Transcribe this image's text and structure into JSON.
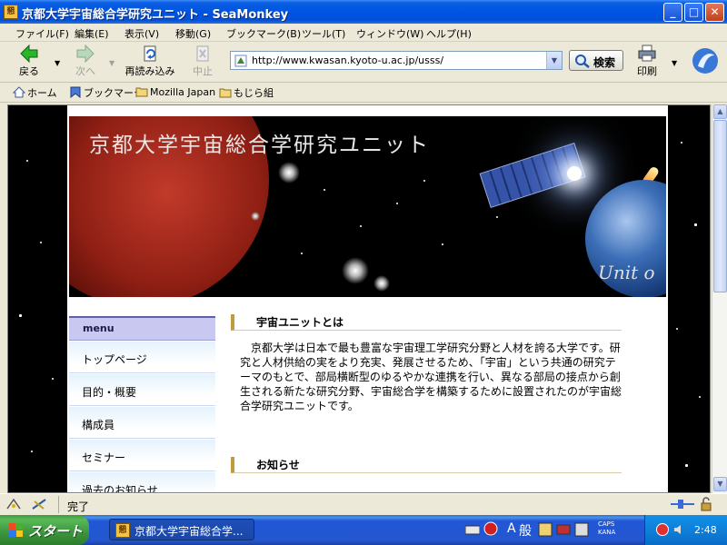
{
  "window": {
    "title": "京都大学宇宙総合学研究ユニット - SeaMonkey",
    "app_icon": "seamonkey-page-icon",
    "controls": {
      "minimize": "_",
      "maximize": "□",
      "close": "✕"
    }
  },
  "menubar": {
    "items": [
      "ファイル(F)",
      "編集(E)",
      "表示(V)",
      "移動(G)",
      "ブックマーク(B)",
      "ツール(T)",
      "ウィンドウ(W)",
      "ヘルプ(H)"
    ]
  },
  "navbar": {
    "back": "戻る",
    "forward": "次へ",
    "reload": "再読み込み",
    "stop": "中止",
    "url": "http://www.kwasan.kyoto-u.ac.jp/usss/",
    "search": "検索",
    "print": "印刷"
  },
  "personal_toolbar": {
    "items": [
      "ホーム",
      "ブックマーク",
      "Mozilla Japan",
      "もじら組"
    ]
  },
  "page": {
    "banner_title": "京都大学宇宙総合学研究ユニット",
    "banner_subtitle": "Unit o",
    "menu": {
      "heading": "menu",
      "items": [
        "トップページ",
        "目的・概要",
        "構成員",
        "セミナー",
        "過去のお知らせ"
      ]
    },
    "sections": [
      {
        "heading": "宇宙ユニットとは",
        "body": "京都大学は日本で最も豊富な宇宙理工学研究分野と人材を誇る大学です。研究と人材供給の実をより充実、発展させるため、「宇宙」という共通の研究テーマのもとで、部局横断型のゆるやかな連携を行い、異なる部局の接点から創生される新たな研究分野、宇宙総合学を構築するために設置されたのが宇宙総合学研究ユニットです。"
      },
      {
        "heading": "お知らせ"
      }
    ]
  },
  "statusbar": {
    "text": "完了"
  },
  "taskbar": {
    "start": "スタート",
    "task_item": "京都大学宇宙総合学...",
    "lang_a": "A",
    "lang_mode": "般",
    "caps": "CAPS",
    "kana": "KANA",
    "clock": "2:48"
  },
  "colors": {
    "titlebar": "#0054e3",
    "menu_heading_bg": "#c8c8f0",
    "section_accent": "#c49a3c",
    "taskbar": "#2457cf",
    "start_button": "#3d943d"
  }
}
